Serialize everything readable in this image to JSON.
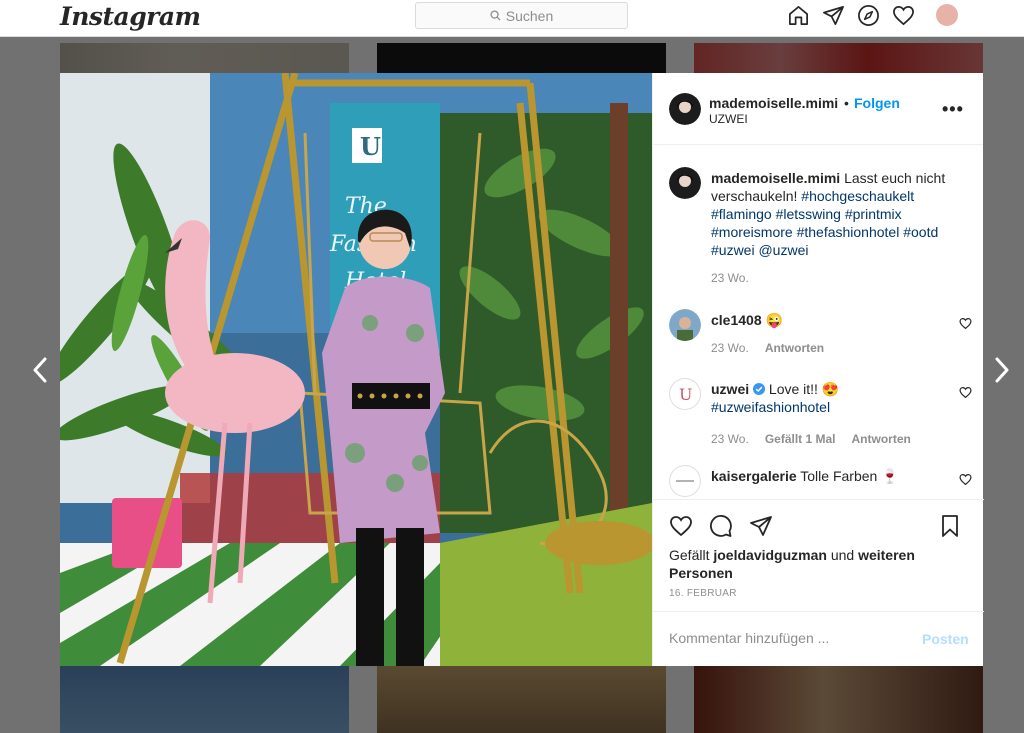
{
  "app": {
    "logo": "Instagram"
  },
  "search": {
    "placeholder": "Suchen"
  },
  "nav": {
    "icons": [
      "home-icon",
      "direct-icon",
      "explore-icon",
      "activity-heart-icon",
      "profile-avatar"
    ]
  },
  "post": {
    "header": {
      "username": "mademoiselle.mimi",
      "separator": "•",
      "follow_label": "Folgen",
      "location": "UZWEI",
      "more_label": "•••"
    },
    "caption": {
      "username": "mademoiselle.mimi",
      "text": "Lasst euch nicht verschaukeln!",
      "hashtags": "#hochgeschaukelt #flamingo #letsswing #printmix #moreismore #thefashionhotel #ootd #uzwei @uzwei",
      "time": "23 Wo."
    },
    "comments": [
      {
        "username": "cle1408",
        "text": "😜",
        "time": "23 Wo.",
        "likes": "",
        "reply": "Antworten"
      },
      {
        "username": "uzwei",
        "verified": true,
        "text": "Love it!! 😍",
        "tag": "#uzweifashionhotel",
        "time": "23 Wo.",
        "likes": "Gefällt 1 Mal",
        "reply": "Antworten"
      },
      {
        "username": "kaisergalerie",
        "text": "Tolle Farben 🍷"
      }
    ],
    "likes": {
      "prefix": "Gefällt",
      "user": "joeldavidguzman",
      "connector": "und",
      "others": "weiteren Personen"
    },
    "date": "16. FEBRUAR",
    "comment_input": {
      "placeholder": "Kommentar hinzufügen ...",
      "post_label": "Posten"
    }
  },
  "colors": {
    "accent": "#0095f6",
    "post_disabled": "#b2dffc",
    "overlay": "rgba(0,0,0,0.55)"
  }
}
